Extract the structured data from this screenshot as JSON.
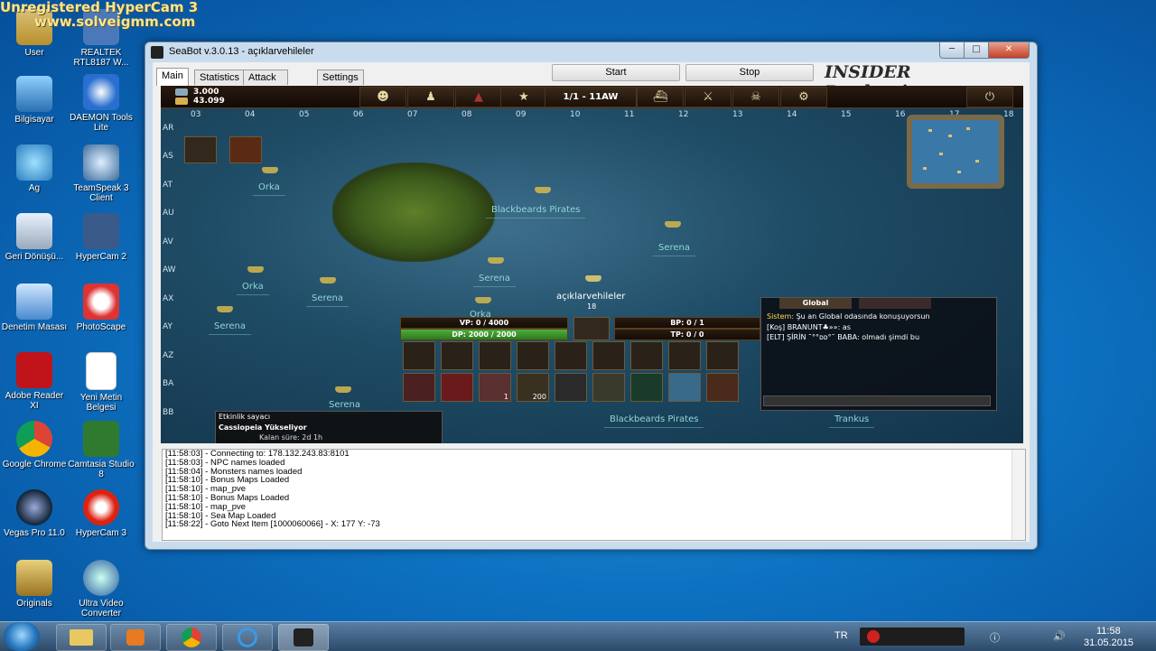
{
  "watermark": {
    "line1": "Unregistered HyperCam 3",
    "line2": "www.solveigmm.com"
  },
  "desktop": {
    "icons": [
      {
        "label": "User"
      },
      {
        "label": "REALTEK RTL8187 W..."
      },
      {
        "label": "Bilgisayar"
      },
      {
        "label": "DAEMON Tools Lite"
      },
      {
        "label": "Ag"
      },
      {
        "label": "TeamSpeak 3 Client"
      },
      {
        "label": "Geri Dönüşü..."
      },
      {
        "label": "HyperCam 2"
      },
      {
        "label": "Denetim Masası"
      },
      {
        "label": "PhotoScape"
      },
      {
        "label": "Adobe Reader XI"
      },
      {
        "label": "Yeni Metin Belgesi"
      },
      {
        "label": "Google Chrome"
      },
      {
        "label": "Camtasia Studio 8"
      },
      {
        "label": "Vegas Pro 11.0"
      },
      {
        "label": "HyperCam 3"
      },
      {
        "label": "Originals"
      },
      {
        "label": "Ultra Video Converter"
      }
    ]
  },
  "window": {
    "title": "SeaBot v.3.0.13 - açıklarvehileler",
    "tabs": [
      "Main",
      "Statistics",
      "Attack Options",
      "Settings"
    ],
    "start_label": "Start",
    "stop_label": "Stop",
    "brand": "INSIDER Productions"
  },
  "game": {
    "resource1": "3.000",
    "resource2": "43.099",
    "day": "1/1 - 11AW",
    "columns": [
      "03",
      "04",
      "05",
      "06",
      "07",
      "08",
      "09",
      "10",
      "11",
      "12",
      "13",
      "14",
      "15",
      "16",
      "17",
      "18"
    ],
    "rows": [
      "AR",
      "AS",
      "AT",
      "AU",
      "AV",
      "AW",
      "AX",
      "AY",
      "AZ",
      "BA",
      "BB"
    ],
    "npcs": [
      "Orka",
      "Blackbeards Pirates",
      "Serena",
      "Orka",
      "Serena",
      "Serena",
      "Serena",
      "Orka",
      "Blackbeards Pirates",
      "Trankus",
      "Serena"
    ],
    "player_name": "açıklarvehileler",
    "player_level": "18",
    "vp": "VP: 0 / 4000",
    "dp": "DP: 2000 / 2000",
    "bp": "BP: 0 / 1",
    "tp": "TP: 0 / 0",
    "slot_counts": [
      "1",
      "200"
    ],
    "event": {
      "header": "Etkinlik sayacı",
      "title": "Cassiopeia Yükseliyor",
      "sub": "Kalan süre: 2d 1h"
    },
    "chat": {
      "tab": "Global",
      "line1_sys": "Sistem:",
      "line1": "Şu an Global odasında konuşuyorsun",
      "line2": "[Koş] BRANUNT♣»»: as",
      "line3": "[ELT] ŞİRİN ˜°°ᴅᴅ°˜ BABA: olmadı şimdi bu"
    }
  },
  "log": [
    "[11:58:03] - Connecting to: 178.132.243.83:8101",
    "[11:58:03] - NPC names loaded",
    "[11:58:04] - Monsters names loaded",
    "[11:58:10] - Bonus Maps Loaded",
    "[11:58:10] - map_pve",
    "[11:58:10] - Bonus Maps Loaded",
    "[11:58:10] - map_pve",
    "[11:58:10] - Sea Map Loaded",
    "[11:58:22] - Goto Next Item [1000060066] - X: 177 Y: -73"
  ],
  "taskbar": {
    "lang": "TR",
    "time": "11:58",
    "date": "31.05.2015"
  },
  "colors": {
    "desktop": "#0d72c2",
    "npc": "#8fd6d6",
    "close": "#c4402a"
  }
}
